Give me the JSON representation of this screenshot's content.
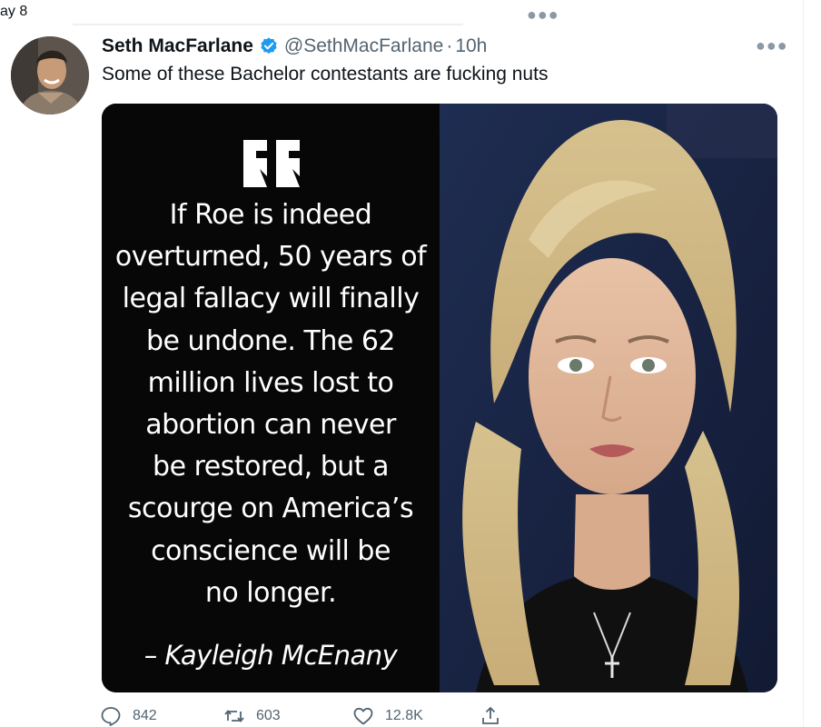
{
  "top_strip": {
    "date_fragment": "ay 8",
    "more_icon": "more-horizontal-icon"
  },
  "tweet": {
    "author": {
      "name": "Seth MacFarlane",
      "verified_icon": "verified-badge-icon",
      "handle": "@SethMacFarlane",
      "separator": "·",
      "timestamp": "10h"
    },
    "more_icon": "more-horizontal-icon",
    "text": "Some of these Bachelor contestants are fucking nuts",
    "media": {
      "quote_lines": [
        "If Roe is indeed",
        "overturned, 50 years of",
        "legal fallacy will finally",
        "be undone. The 62",
        "million lives lost to",
        "abortion can never",
        "be restored, but a",
        "scourge on America’s",
        "conscience will be",
        "no longer."
      ],
      "attribution": "– Kayleigh McEnany"
    },
    "actions": {
      "reply": {
        "icon": "reply-icon",
        "count": "842"
      },
      "retweet": {
        "icon": "retweet-icon",
        "count": "603"
      },
      "like": {
        "icon": "like-heart-icon",
        "count": "12.8K"
      },
      "share": {
        "icon": "share-icon"
      }
    }
  },
  "colors": {
    "text_primary": "#0f1419",
    "text_secondary": "#536471",
    "verified_blue": "#1d9bf0",
    "media_background": "#000000"
  }
}
